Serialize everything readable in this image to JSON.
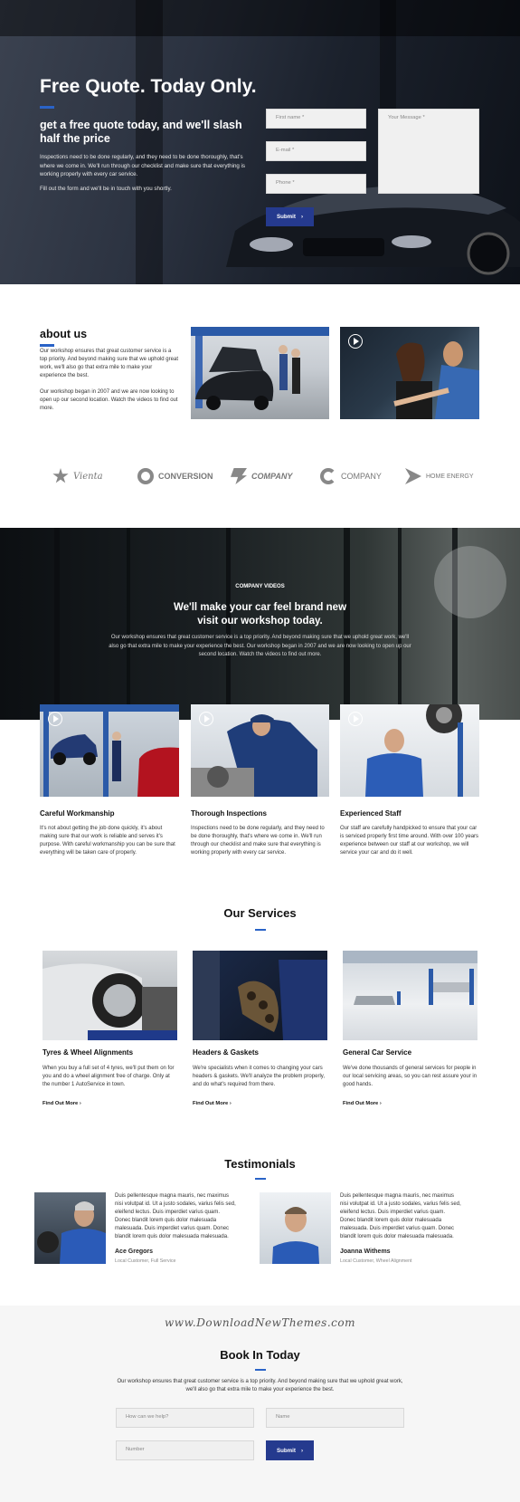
{
  "hero": {
    "title": "Free Quote. Today Only.",
    "subtitle": "get a free quote today, and we'll slash half the price",
    "p1": "Inspections need to be done regularly, and they need to be done thoroughly, that's where we come in. We'll run through our checklist and make sure that everything is working properly with every car service.",
    "p2": "Fill out the form and we'll be in touch with you shortly.",
    "form": {
      "first_name_placeholder": "First name *",
      "email_placeholder": "E-mail *",
      "phone_placeholder": "Phone *",
      "message_placeholder": "Your Message *",
      "submit_label": "Submit"
    }
  },
  "about": {
    "title": "about us",
    "p1": "Our workshop ensures that great customer service is a top priority. And beyond making sure that we uphold great work, we'll also go that extra mile to make your experience the best.",
    "p2": "Our workshop began in 2007 and we are now looking to open up our second location. Watch the videos to find out more."
  },
  "logos": [
    {
      "name": "Vienta",
      "icon": "star-logo-icon"
    },
    {
      "name": "CONVERSION",
      "icon": "ring-logo-icon"
    },
    {
      "name": "COMPANY",
      "icon": "bolt-logo-icon"
    },
    {
      "name": "COMPANY",
      "icon": "g-logo-icon"
    },
    {
      "name": "HOME ENERGY",
      "icon": "arrow-logo-icon"
    }
  ],
  "videos": {
    "label": "COMPANY VIDEOS",
    "title_line1": "We'll make your car feel brand new",
    "title_line2": "visit our workshop today.",
    "text": "Our workshop ensures that great customer service is a top priority. And beyond making sure that we uphold great work, we'll also go that extra mile to make your experience the best. Our workshop began in 2007 and we are now looking to open up our second location. Watch the videos to find out more."
  },
  "features": [
    {
      "title": "Careful Workmanship",
      "text": "It's not about getting the job done quickly, it's about making sure that our work is reliable and serves it's purpose. With careful workmanship you can be sure that everything will be taken care of properly."
    },
    {
      "title": "Thorough Inspections",
      "text": "Inspections need to be done regularly, and they need to be done thoroughly, that's where we come in. We'll run through our checklist and make sure that everything is working properly with every car service."
    },
    {
      "title": "Experienced Staff",
      "text": "Our staff are carefully handpicked to ensure that your car is serviced properly first time around. With over 100 years experience between our staff at our workshop, we will service your car and do it well."
    }
  ],
  "services": {
    "title": "Our Services",
    "items": [
      {
        "title": "Tyres & Wheel Alignments",
        "text": "When you buy a full set of 4 tyres, we'll put them on for you and do a wheel alignment free of charge. Only at the number 1 AutoService in town.",
        "link": "Find Out More"
      },
      {
        "title": "Headers & Gaskets",
        "text": "We're specialists when it comes to changing your cars headers & gaskets. We'll analyze the problem properly, and do what's required from there.",
        "link": "Find Out More"
      },
      {
        "title": "General Car Service",
        "text": "We've done thousands of general services for people in our local servicing areas, so you can rest assure your in good hands.",
        "link": "Find Out More"
      }
    ]
  },
  "testimonials": {
    "title": "Testimonials",
    "items": [
      {
        "quote": "Duis pellentesque magna mauris, nec maximus nisi volutpat id. Ut a justo sodales, varius felis sed, eleifend lectus. Duis imperdiet varius quam. Donec blandit lorem quis dolor malesuada malesuada. Duis imperdiet varius quam. Donec blandit lorem quis dolor malesuada malesuada.",
        "name": "Ace Gregors",
        "role": "Local Customer, Full Service"
      },
      {
        "quote": "Duis pellentesque magna mauris, nec maximus nisi volutpat id. Ut a justo sodales, varius felis sed, eleifend lectus. Duis imperdiet varius quam. Donec blandit lorem quis dolor malesuada malesuada. Duis imperdiet varius quam. Donec blandit lorem quis dolor malesuada malesuada.",
        "name": "Joanna Withems",
        "role": "Local Customer, Wheel Alignment"
      }
    ]
  },
  "watermark": "www.DownloadNewThemes.com",
  "book": {
    "title": "Book In Today",
    "text": "Our workshop ensures that great customer service is a top priority. And beyond making sure that we uphold great work, we'll also go that extra mile to make your experience the best.",
    "help_placeholder": "How can we help?",
    "name_placeholder": "Name",
    "number_placeholder": "Number",
    "submit_label": "Submit"
  },
  "colors": {
    "accent": "#2a63c7",
    "button": "#253a8e"
  }
}
